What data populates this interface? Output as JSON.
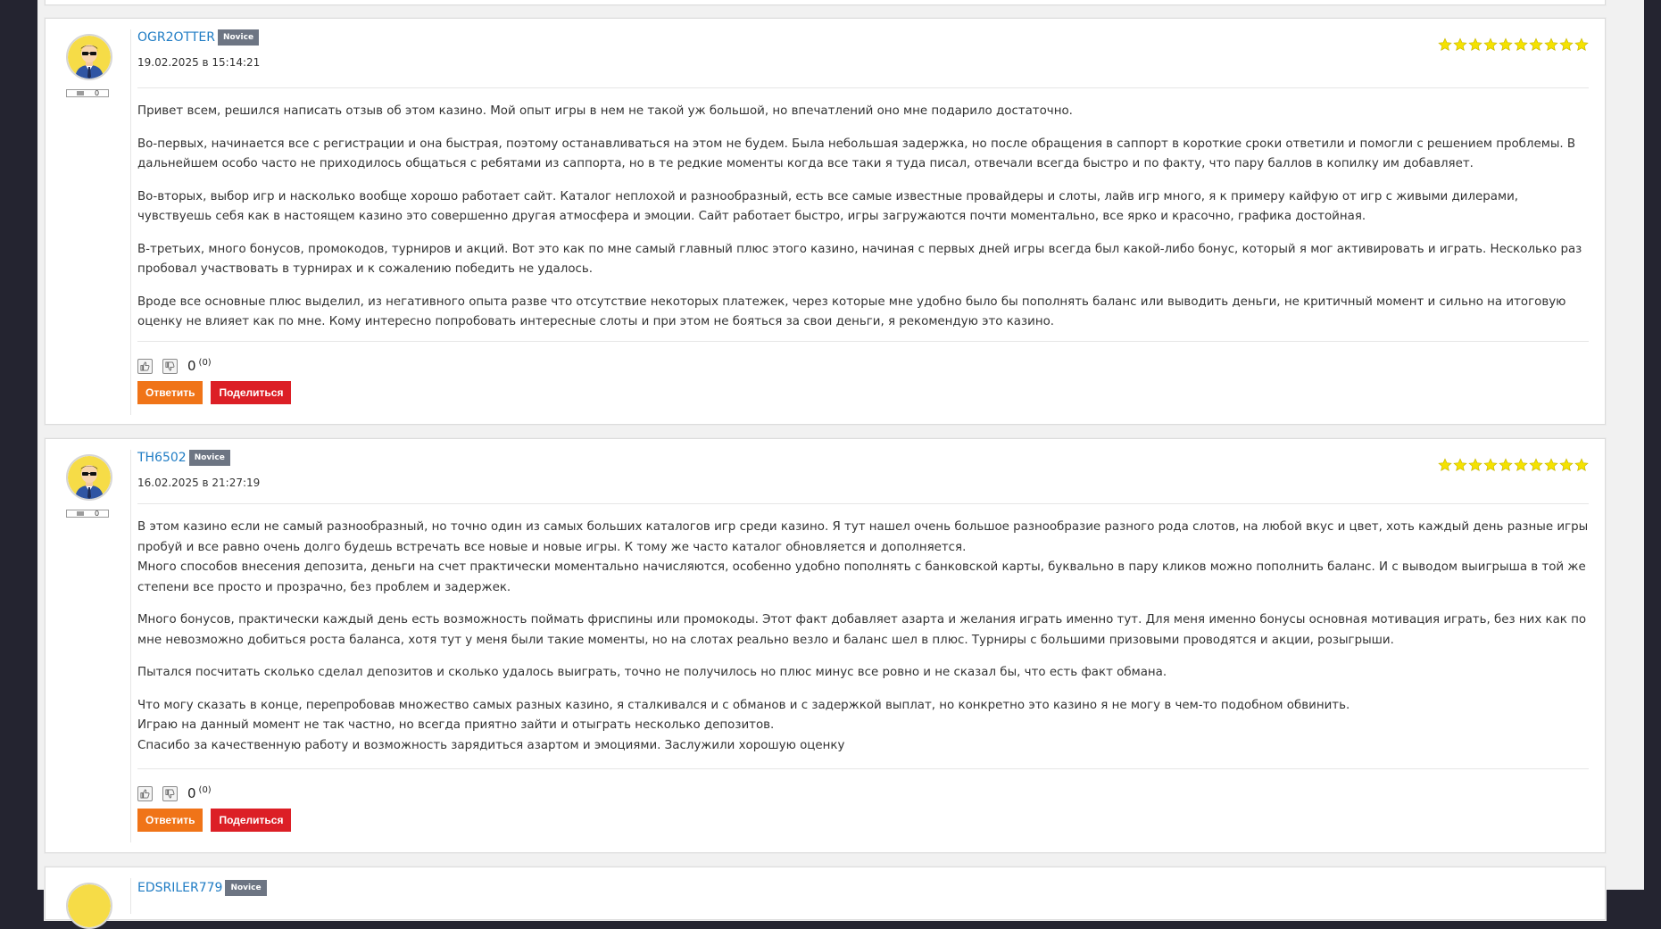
{
  "reviews": [
    {
      "username": "OGR2OTTER",
      "badge": "Novice",
      "date": "19.02.2025 в 15:14:21",
      "reputation": "0",
      "stars": 10,
      "paragraphs": [
        "Привет всем, решился написать отзыв об этом казино. Мой опыт игры в нем не такой уж большой, но впечатлений оно мне подарило достаточно.",
        "Во-первых, начинается все с регистрации и она быстрая, поэтому останавливаться на этом не будем. Была небольшая задержка, но после обращения в саппорт в короткие сроки ответили и помогли с решением проблемы. В дальнейшем особо часто не приходилось общаться с ребятами из саппорта, но в те редкие моменты когда все таки я туда писал, отвечали всегда быстро и по факту, что пару баллов в копилку им добавляет.",
        "Во-вторых, выбор игр и насколько вообще хорошо работает сайт. Каталог неплохой и разнообразный, есть все самые известные провайдеры и слоты, лайв игр много, я к примеру кайфую от игр с живыми дилерами, чувствуешь себя как в настоящем казино это совершенно другая атмосфера и эмоции. Сайт работает быстро, игры загружаются почти моментально, все ярко и красочно, графика достойная.",
        "В-третьих, много бонусов, промокодов, турниров и акций. Вот это как по мне самый главный плюс этого казино, начиная с первых дней игры всегда был какой-либо бонус, который я мог активировать и играть. Несколько раз пробовал участвовать в турнирах и к сожалению победить не удалось.",
        "Вроде все основные плюс выделил, из негативного опыта разве что отсутствие некоторых платежек, через которые мне удобно было бы пополнять баланс или выводить деньги, не критичный момент и сильно на итоговую оценку не влияет как по мне. Кому интересно попробовать интересные слоты и при этом не бояться за свои деньги, я рекомендую это казино."
      ],
      "votes": "0",
      "votes_count": "(0)"
    },
    {
      "username": "TH6502",
      "badge": "Novice",
      "date": "16.02.2025 в 21:27:19",
      "reputation": "0",
      "stars": 10,
      "paragraphs": [
        "В этом казино если не самый разнообразный, но точно один из самых больших каталогов игр среди казино. Я тут нашел очень большое разнообразие разного рода слотов, на любой вкус и цвет, хоть каждый день разные игры пробуй и все равно очень долго будешь встречать все новые и новые игры. К тому же часто каталог обновляется и дополняется.\nМного способов внесения депозита, деньги на счет практически моментально начисляются, особенно удобно пополнять с банковской карты, буквально в пару кликов можно пополнить баланс. И с выводом выигрыша в той же степени все просто и прозрачно, без проблем и задержек.",
        "Много бонусов, практически каждый день есть возможность поймать фриспины или промокоды. Этот факт добавляет азарта и желания играть именно тут. Для меня именно бонусы основная мотивация играть, без них как по мне невозможно добиться роста баланса, хотя тут у меня были такие моменты, но на слотах реально везло и баланс шел в плюс. Турниры с большими призовыми проводятся и акции, розыгрыши.",
        "Пытался посчитать сколько сделал депозитов и сколько удалось выиграть, точно не получилось но плюс минус все ровно и не сказал бы, что есть факт обмана.",
        "Что могу сказать в конце, перепробовав множество самых разных казино, я сталкивался и с обманов и с задержкой выплат, но конкретно это казино я не могу в чем-то подобном обвинить.\nИграю на данный момент не так частно, но всегда приятно зайти и отыграть несколько депозитов.\nСпасибо за качественную работу и возможность зарядиться азартом и эмоциями. Заслужили хорошую оценку"
      ],
      "votes": "0",
      "votes_count": "(0)"
    },
    {
      "username": "EDSRILER779",
      "badge": "Novice"
    }
  ],
  "buttons": {
    "reply": "Ответить",
    "share": "Поделиться"
  },
  "icons": {
    "like": "thumbs-up-icon",
    "dislike": "thumbs-down-icon",
    "star": "star-icon",
    "avatar": "user-avatar-icon"
  },
  "colors": {
    "username": "#1f7cc4",
    "badge": "#6d7583",
    "reply": "#f07418",
    "share": "#dc1f26",
    "star": "#f5e200"
  }
}
